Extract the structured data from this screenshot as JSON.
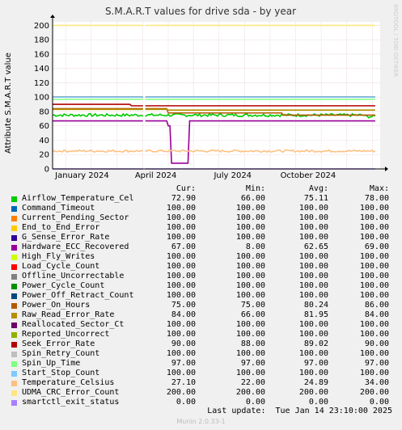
{
  "header": {
    "title": "S.M.A.R.T values for drive sda - by year"
  },
  "side_label": "RRDTOOL / TOBI OETIKER",
  "legend_header": {
    "cur": "Cur:",
    "min": "Min:",
    "avg": "Avg:",
    "max": "Max:"
  },
  "last_update": "Last update:  Tue Jan 14 23:10:00 2025",
  "footer": "Munin 2.0.33-1",
  "chart_data": {
    "type": "line",
    "title": "S.M.A.R.T values for drive sda - by year",
    "xlabel": "",
    "ylabel": "Attribute S.M.A.R.T value",
    "ylim": [
      0,
      205
    ],
    "yticks": [
      0,
      20,
      40,
      60,
      80,
      100,
      120,
      140,
      160,
      180,
      200
    ],
    "x_tick_labels": [
      "January 2024",
      "April 2024",
      "July 2024",
      "October 2024"
    ],
    "grid": true,
    "legend_placement": "bottom",
    "series": [
      {
        "name": "Airflow_Temperature_Cel",
        "color": "#00cc00",
        "cur": "72.90",
        "min": "66.00",
        "avg": "75.11",
        "max": "78.00"
      },
      {
        "name": "Command_Timeout",
        "color": "#0066b3",
        "cur": "100.00",
        "min": "100.00",
        "avg": "100.00",
        "max": "100.00"
      },
      {
        "name": "Current_Pending_Sector",
        "color": "#ff8000",
        "cur": "100.00",
        "min": "100.00",
        "avg": "100.00",
        "max": "100.00"
      },
      {
        "name": "End_to_End_Error",
        "color": "#ffcc00",
        "cur": "100.00",
        "min": "100.00",
        "avg": "100.00",
        "max": "100.00"
      },
      {
        "name": "G_Sense_Error_Rate",
        "color": "#330099",
        "cur": "100.00",
        "min": "100.00",
        "avg": "100.00",
        "max": "100.00"
      },
      {
        "name": "Hardware_ECC_Recovered",
        "color": "#990099",
        "cur": "67.00",
        "min": "8.00",
        "avg": "62.65",
        "max": "69.00"
      },
      {
        "name": "High_Fly_Writes",
        "color": "#ccff00",
        "cur": "100.00",
        "min": "100.00",
        "avg": "100.00",
        "max": "100.00"
      },
      {
        "name": "Load_Cycle_Count",
        "color": "#ff0000",
        "cur": "100.00",
        "min": "100.00",
        "avg": "100.00",
        "max": "100.00"
      },
      {
        "name": "Offline_Uncorrectable",
        "color": "#808080",
        "cur": "100.00",
        "min": "100.00",
        "avg": "100.00",
        "max": "100.00"
      },
      {
        "name": "Power_Cycle_Count",
        "color": "#008f00",
        "cur": "100.00",
        "min": "100.00",
        "avg": "100.00",
        "max": "100.00"
      },
      {
        "name": "Power_Off_Retract_Count",
        "color": "#00487d",
        "cur": "100.00",
        "min": "100.00",
        "avg": "100.00",
        "max": "100.00"
      },
      {
        "name": "Power_On_Hours",
        "color": "#b35a00",
        "cur": "75.00",
        "min": "75.00",
        "avg": "80.24",
        "max": "86.00"
      },
      {
        "name": "Raw_Read_Error_Rate",
        "color": "#b38f00",
        "cur": "84.00",
        "min": "66.00",
        "avg": "81.95",
        "max": "84.00"
      },
      {
        "name": "Reallocated_Sector_Ct",
        "color": "#6b006b",
        "cur": "100.00",
        "min": "100.00",
        "avg": "100.00",
        "max": "100.00"
      },
      {
        "name": "Reported_Uncorrect",
        "color": "#8fb300",
        "cur": "100.00",
        "min": "100.00",
        "avg": "100.00",
        "max": "100.00"
      },
      {
        "name": "Seek_Error_Rate",
        "color": "#b30000",
        "cur": "90.00",
        "min": "88.00",
        "avg": "89.02",
        "max": "90.00"
      },
      {
        "name": "Spin_Retry_Count",
        "color": "#bebebe",
        "cur": "100.00",
        "min": "100.00",
        "avg": "100.00",
        "max": "100.00"
      },
      {
        "name": "Spin_Up_Time",
        "color": "#80ff80",
        "cur": "97.00",
        "min": "97.00",
        "avg": "97.00",
        "max": "97.00"
      },
      {
        "name": "Start_Stop_Count",
        "color": "#80c9ff",
        "cur": "100.00",
        "min": "100.00",
        "avg": "100.00",
        "max": "100.00"
      },
      {
        "name": "Temperature_Celsius",
        "color": "#ffc080",
        "cur": "27.10",
        "min": "22.00",
        "avg": "24.89",
        "max": "34.00"
      },
      {
        "name": "UDMA_CRC_Error_Count",
        "color": "#ffe680",
        "cur": "200.00",
        "min": "200.00",
        "avg": "200.00",
        "max": "200.00"
      },
      {
        "name": "smartctl_exit_status",
        "color": "#aa80ff",
        "cur": "0.00",
        "min": "0.00",
        "avg": "0.00",
        "max": "0.00"
      }
    ]
  }
}
